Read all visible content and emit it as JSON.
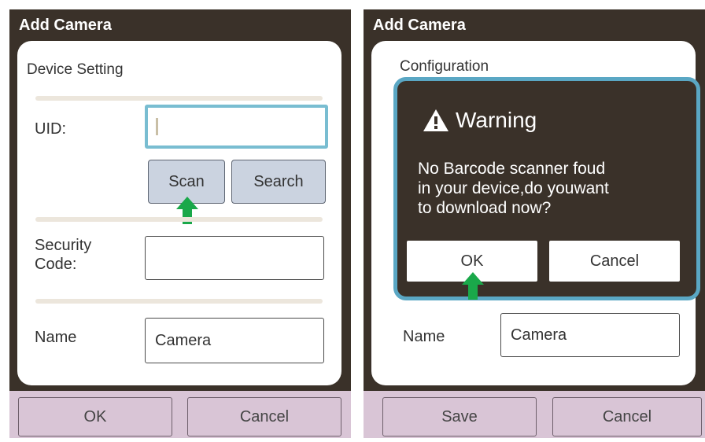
{
  "left": {
    "title": "Add Camera",
    "section_title": "Device Setting",
    "uid_label": "UID:",
    "uid_value": "",
    "scan_label": "Scan",
    "search_label": "Search",
    "security_label_line1": "Security",
    "security_label_line2": "Code:",
    "security_value": "",
    "name_label": "Name",
    "name_value": "Camera",
    "ok_label": "OK",
    "cancel_label": "Cancel"
  },
  "right": {
    "title": "Add Camera",
    "section_title": "Configuration",
    "dialog": {
      "title": "Warning",
      "message_line1": "No Barcode scanner foud",
      "message_line2": "in your device,do youwant",
      "message_line3": "to download now?",
      "ok_label": "OK",
      "cancel_label": "Cancel"
    },
    "name_label": "Name",
    "name_value": "Camera",
    "save_label": "Save",
    "cancel_label": "Cancel"
  },
  "colors": {
    "frame": "#3a3129",
    "bottom_bar": "#d9c5d6",
    "focus_border": "#79bdd1",
    "button_blue": "#cbd3e0",
    "arrow_green": "#1aa84a",
    "dialog_border": "#5aa7c4"
  },
  "icons": [
    "warning-icon",
    "green-up-arrow-icon"
  ]
}
